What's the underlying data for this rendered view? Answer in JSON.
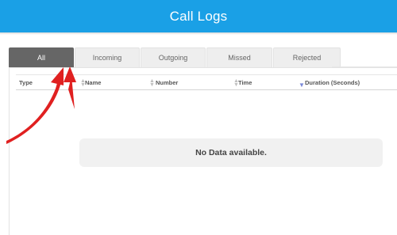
{
  "header": {
    "title": "Call Logs"
  },
  "tabs": [
    {
      "label": "All",
      "active": true
    },
    {
      "label": "Incoming",
      "active": false
    },
    {
      "label": "Outgoing",
      "active": false
    },
    {
      "label": "Missed",
      "active": false
    },
    {
      "label": "Rejected",
      "active": false
    }
  ],
  "table": {
    "columns": [
      {
        "label": "Type",
        "sort_icon": "sort-both-icon"
      },
      {
        "label": "Name",
        "sort_icon": "sort-both-icon"
      },
      {
        "label": "Number",
        "sort_icon": "sort-both-icon"
      },
      {
        "label": "Time",
        "sort_icon": "sort-desc-icon"
      },
      {
        "label": "Duration (Seconds)"
      }
    ],
    "empty_message": "No Data available."
  },
  "colors": {
    "header_bg": "#1aa0e6",
    "active_tab_bg": "#666666",
    "inactive_tab_bg": "#eeeeee",
    "annotation": "#e02020",
    "sort_active": "#7a88d8"
  }
}
